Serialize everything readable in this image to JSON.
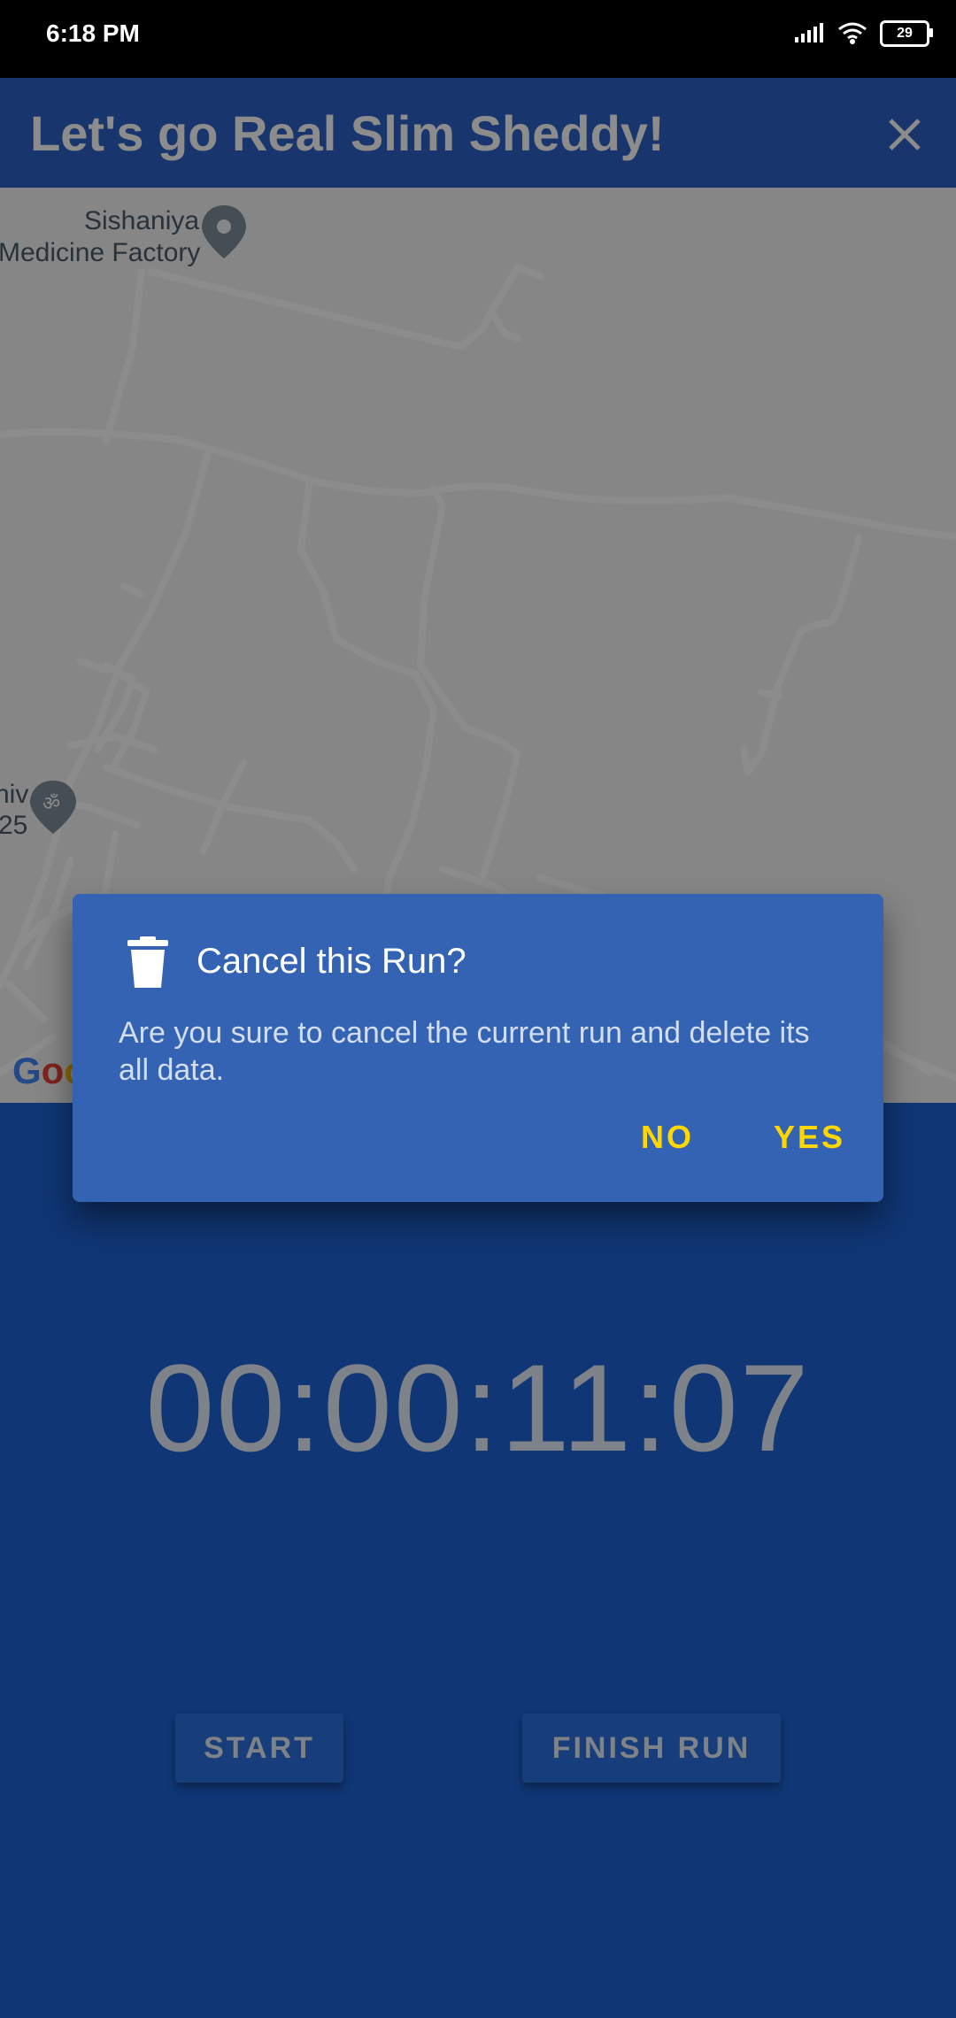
{
  "status_bar": {
    "time": "6:18 PM",
    "battery_level": "29",
    "icons": [
      "signal-icon",
      "wifi-icon",
      "battery-icon"
    ]
  },
  "app_bar": {
    "title": "Let's go Real Slim Sheddy!",
    "close_icon": "close-icon"
  },
  "map": {
    "labels": {
      "place_1_line_1": "Sishaniya",
      "place_1_line_2": "Medicine Factory",
      "place_2_line_1": "hiv",
      "place_2_line_2": "25"
    },
    "attribution": "Goo"
  },
  "main": {
    "timer": "00:00:11:07",
    "start_label": "START",
    "finish_label": "FINISH RUN"
  },
  "dialog": {
    "title": "Cancel this Run?",
    "message": "Are you sure to cancel the current run and delete its all data.",
    "no_label": "NO",
    "yes_label": "YES",
    "icon": "trash-icon"
  },
  "colors": {
    "app_bar": "#2e62c6",
    "main_background": "#1e63d6",
    "dialog_background": "#3363b2",
    "dialog_action": "#ffd700"
  }
}
